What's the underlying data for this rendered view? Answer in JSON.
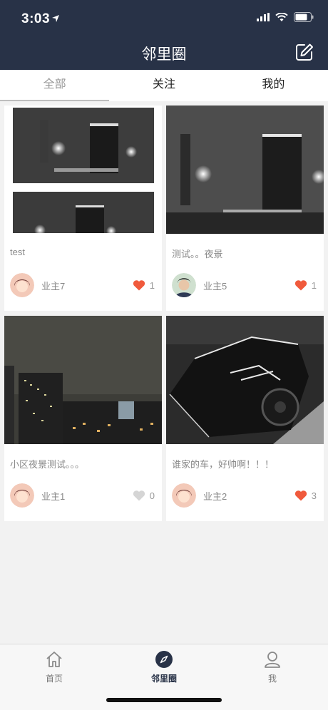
{
  "status_bar": {
    "time": "3:03"
  },
  "header": {
    "title": "邻里圈"
  },
  "tabs": [
    {
      "label": "全部",
      "active": true
    },
    {
      "label": "关注",
      "active": false
    },
    {
      "label": "我的",
      "active": false
    }
  ],
  "posts": [
    {
      "text": "test",
      "author": "业主7",
      "likes": "1",
      "liked": true
    },
    {
      "text": "测试。。夜景",
      "author": "业主5",
      "likes": "1",
      "liked": true
    },
    {
      "text": "小区夜景测试。。。",
      "author": "业主1",
      "likes": "0",
      "liked": false
    },
    {
      "text": "谁家的车，好帅啊！！！",
      "author": "业主2",
      "likes": "3",
      "liked": true
    }
  ],
  "bottom_nav": [
    {
      "label": "首页",
      "icon": "home-icon"
    },
    {
      "label": "邻里圈",
      "icon": "compass-icon",
      "active": true
    },
    {
      "label": "我",
      "icon": "user-icon"
    }
  ],
  "colors": {
    "header_bg": "#283247",
    "like_red": "#f05a3c"
  }
}
